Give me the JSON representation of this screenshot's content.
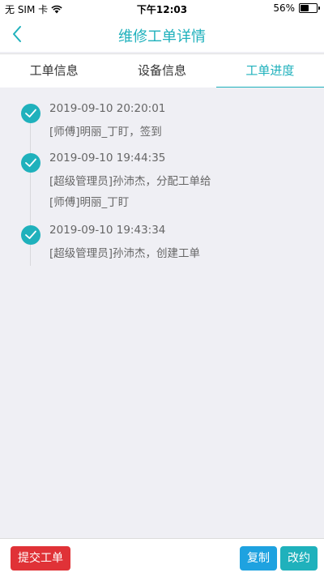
{
  "status_bar": {
    "carrier": "无 SIM 卡",
    "time": "下午12:03",
    "battery_percent": "56%",
    "battery_level": 0.56
  },
  "nav": {
    "title": "维修工单详情",
    "back_icon": "chevron-left-icon"
  },
  "tabs": [
    {
      "label": "工单信息",
      "active": false
    },
    {
      "label": "设备信息",
      "active": false
    },
    {
      "label": "工单进度",
      "active": true
    }
  ],
  "timeline": [
    {
      "time": "2019-09-10 20:20:01",
      "desc": "[师傅]明丽_丁盯，签到"
    },
    {
      "time": "2019-09-10 19:44:35",
      "desc": "[超级管理员]孙沛杰，分配工单给[师傅]明丽_丁盯"
    },
    {
      "time": "2019-09-10 19:43:34",
      "desc": "[超级管理员]孙沛杰，创建工单"
    }
  ],
  "actions": {
    "submit_label": "提交工单",
    "copy_label": "复制",
    "change_label": "改约"
  },
  "colors": {
    "accent": "#1fb1bc",
    "danger": "#e03237",
    "blue": "#1ea2e0"
  }
}
